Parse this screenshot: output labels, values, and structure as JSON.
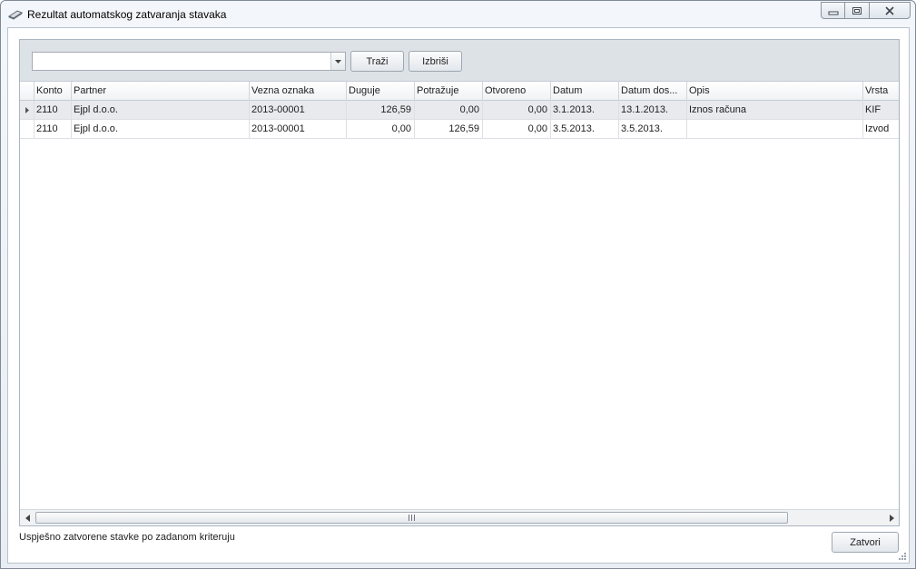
{
  "window": {
    "title": "Rezultat automatskog zatvaranja stavaka",
    "controls": [
      "minimize-icon",
      "restore-icon",
      "close-icon"
    ]
  },
  "toolbar": {
    "search_value": "",
    "search_label": "Traži",
    "clear_label": "Izbriši"
  },
  "grid": {
    "columns": [
      "Konto",
      "Partner",
      "Vezna oznaka",
      "Duguje",
      "Potražuje",
      "Otvoreno",
      "Datum",
      "Datum dos...",
      "Opis",
      "Vrsta"
    ],
    "rows": [
      {
        "konto": "2110",
        "partner": "Ejpl d.o.o.",
        "vezna": "2013-00001",
        "duguje": "126,59",
        "potrazuje": "0,00",
        "otvoreno": "0,00",
        "datum": "3.1.2013.",
        "datum_dos": "13.1.2013.",
        "opis": "Iznos računa",
        "vrsta": "KIF"
      },
      {
        "konto": "2110",
        "partner": "Ejpl d.o.o.",
        "vezna": "2013-00001",
        "duguje": "0,00",
        "potrazuje": "126,59",
        "otvoreno": "0,00",
        "datum": "3.5.2013.",
        "datum_dos": "3.5.2013.",
        "opis": "",
        "vrsta": "Izvod"
      }
    ],
    "selected_row": 0
  },
  "footer": {
    "status_text": "Uspješno zatvorene stavke po zadanom kriteruju",
    "close_label": "Zatvori"
  }
}
